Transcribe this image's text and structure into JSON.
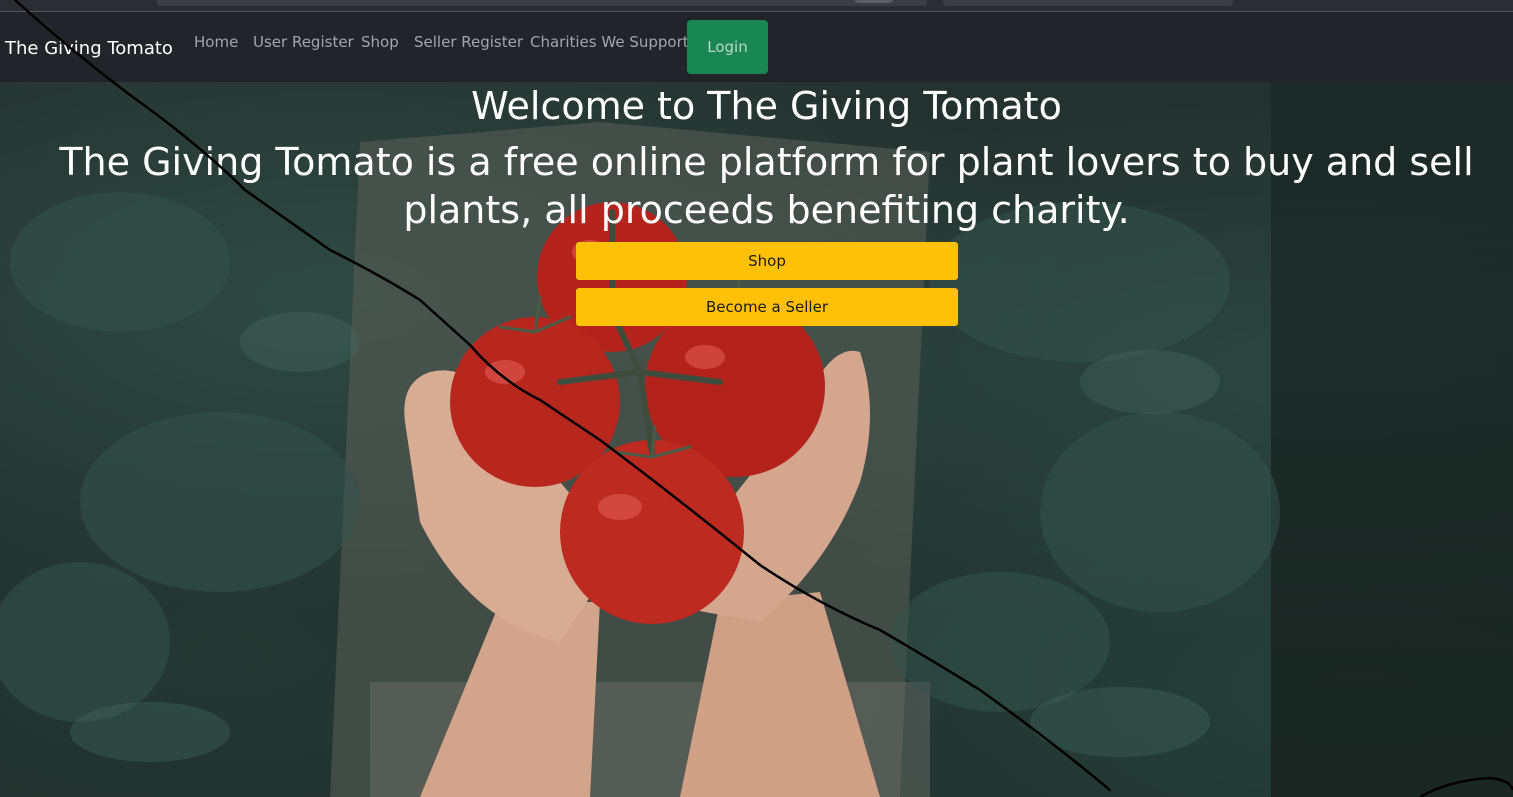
{
  "navbar": {
    "brand": "The Giving Tomato",
    "links": [
      "Home",
      "User Register",
      "Shop",
      "Seller Register",
      "Charities We Support"
    ],
    "login_label": "Login"
  },
  "hero": {
    "title": "Welcome to The Giving Tomato",
    "description": "The Giving Tomato is a free online platform for plant lovers to buy and sell plants, all proceeds benefiting charity.",
    "shop_button": "Shop",
    "seller_button": "Become a Seller"
  },
  "colors": {
    "navbar_bg": "#212529",
    "login_green": "#198754",
    "button_yellow": "#ffc107"
  }
}
